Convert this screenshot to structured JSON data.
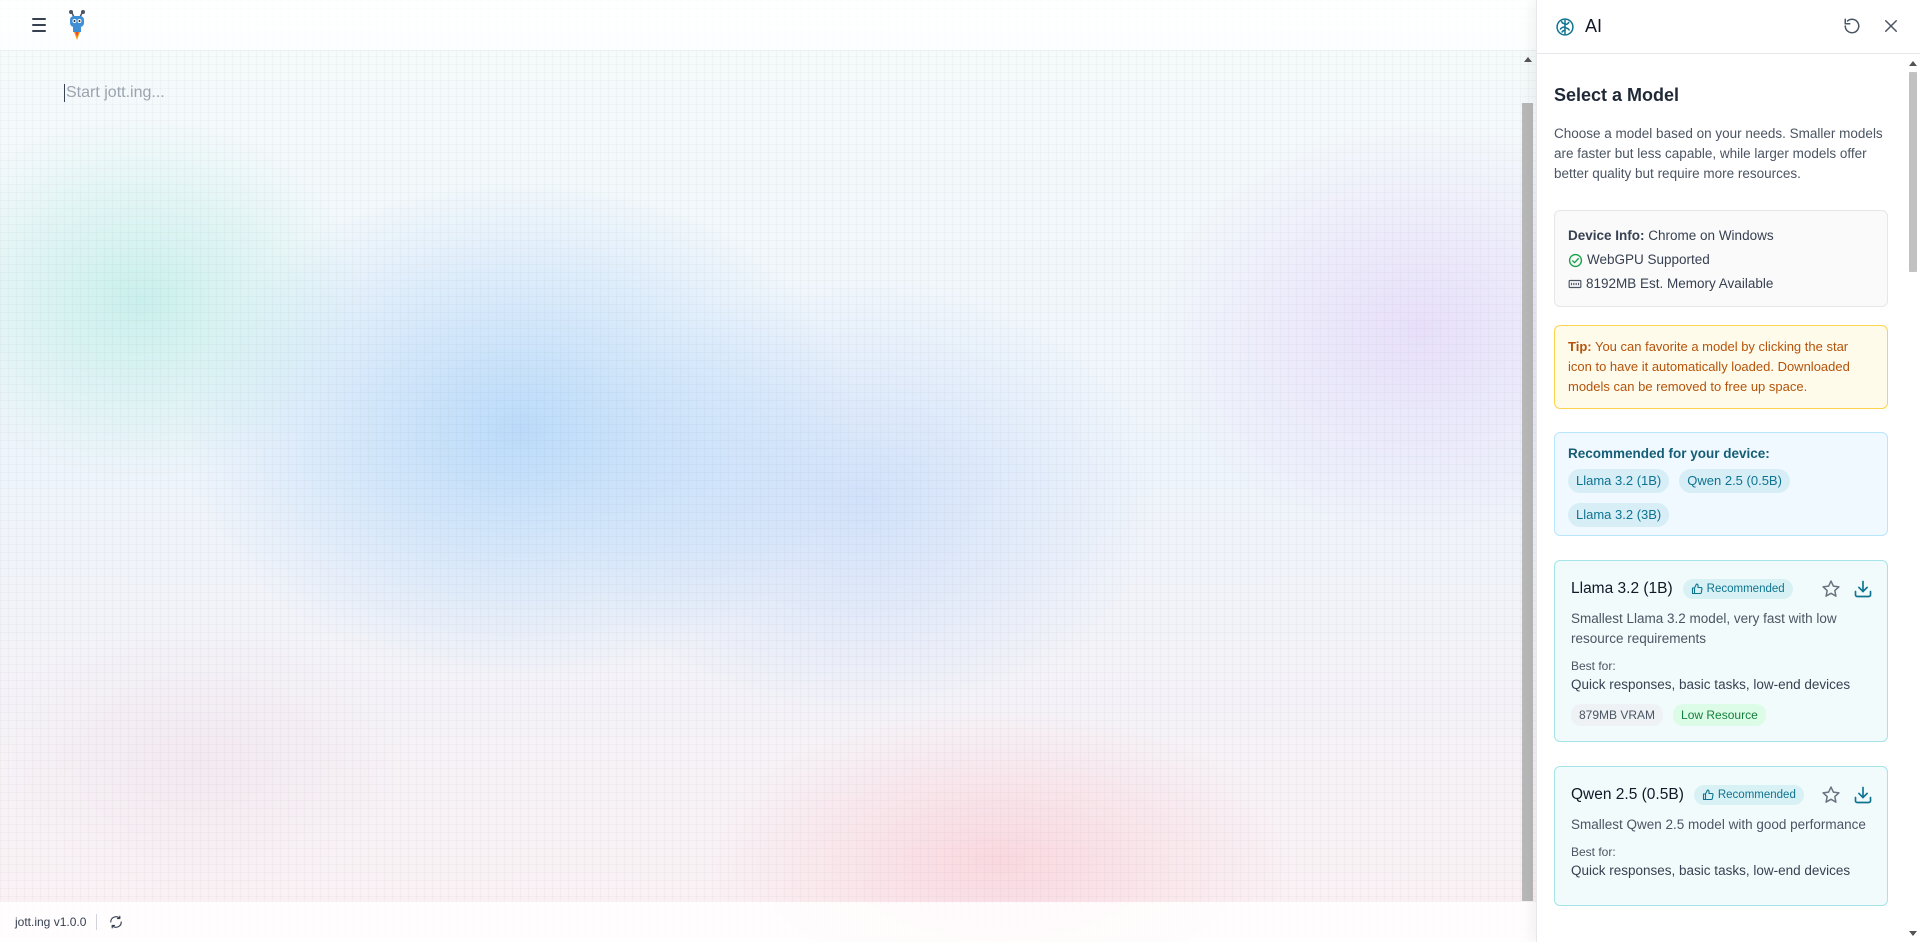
{
  "editor": {
    "placeholder": "Start jott.ing..."
  },
  "footer": {
    "version": "jott.ing v1.0.0"
  },
  "panel": {
    "title": "AI",
    "heading": "Select a Model",
    "intro": "Choose a model based on your needs. Smaller models are faster but less capable, while larger models offer better quality but require more resources.",
    "device": {
      "label": "Device Info:",
      "value": " Chrome on Windows",
      "webgpu": "WebGPU Supported",
      "memory": "8192MB Est. Memory Available"
    },
    "tip": {
      "label": "Tip:",
      "text": " You can favorite a model by clicking the star icon to have it automatically loaded. Downloaded models can be removed to free up space."
    },
    "recommended": {
      "title": "Recommended for your device:",
      "chips": [
        "Llama 3.2 (1B)",
        "Qwen 2.5 (0.5B)",
        "Llama 3.2 (3B)"
      ]
    },
    "models": [
      {
        "name": "Llama 3.2 (1B)",
        "badge": "Recommended",
        "description": "Smallest Llama 3.2 model, very fast with low resource requirements",
        "best_for_label": "Best for:",
        "best_for": "Quick responses, basic tasks, low-end devices",
        "vram": "879MB VRAM",
        "resource": "Low Resource"
      },
      {
        "name": "Qwen 2.5 (0.5B)",
        "badge": "Recommended",
        "description": "Smallest Qwen 2.5 model with good performance",
        "best_for_label": "Best for:",
        "best_for": "Quick responses, basic tasks, low-end devices"
      }
    ]
  },
  "colors": {
    "accent": "#0e7490",
    "success": "#16a34a",
    "tip_text": "#b45309"
  }
}
